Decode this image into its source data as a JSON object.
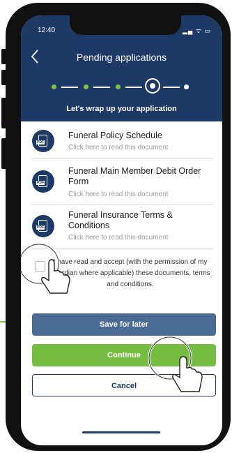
{
  "status_bar": {
    "time": "12:40",
    "icons": "▂▄ ᯤ ▭"
  },
  "header": {
    "back_icon": "chevron-left-icon",
    "title": "Pending applications",
    "subtitle": "Let's wrap up your application"
  },
  "progress": {
    "total_steps": 5,
    "current_step": 4
  },
  "documents": [
    {
      "title": "Funeral Policy Schedule",
      "link": "Click here to read this document",
      "icon": "pdf-document-icon"
    },
    {
      "title": "Funeral Main Member Debit Order Form",
      "link": "Click here to read this document",
      "icon": "pdf-document-icon"
    },
    {
      "title": "Funeral Insurance Terms & Conditions",
      "link": "Click here to read this document",
      "icon": "pdf-document-icon"
    }
  ],
  "pdf_tag": "PDF",
  "consent": {
    "checked": false,
    "text": "I have read and accept (with the permission of my guardian where applicable) these documents, terms and conditions."
  },
  "buttons": {
    "save": "Save for later",
    "continue": "Continue",
    "cancel": "Cancel"
  },
  "colors": {
    "header": "#1d3a66",
    "accent_green": "#78bd43",
    "save_blue": "#4a6c94"
  }
}
